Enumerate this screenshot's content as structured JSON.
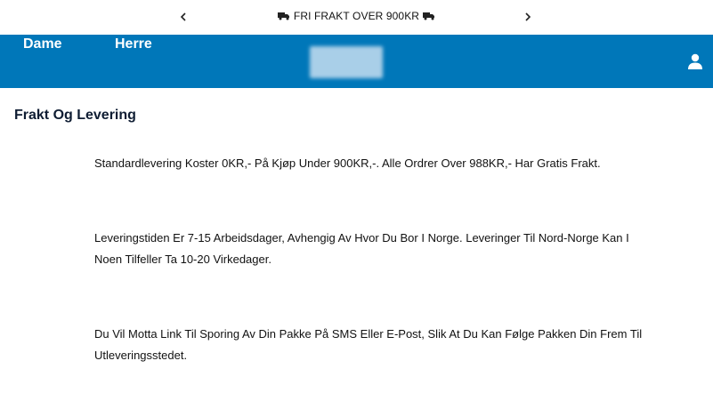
{
  "announcement": {
    "text": "FRI FRAKT OVER 900KR",
    "prev_arrow": "‹",
    "next_arrow": "›"
  },
  "nav": {
    "items": [
      {
        "label": "Dame"
      },
      {
        "label": "Herre"
      }
    ]
  },
  "colors": {
    "header_bg": "#0077b9",
    "title_color": "#0f1d33"
  },
  "page": {
    "title": "Frakt Og Levering",
    "paragraphs": [
      "Standardlevering Koster 0KR,- På Kjøp Under 900KR,-. Alle Ordrer Over 988KR,- Har Gratis Frakt.",
      "Leveringstiden Er 7-15 Arbeidsdager, Avhengig Av Hvor Du Bor I Norge. Leveringer Til Nord-Norge Kan I Noen Tilfeller Ta 10-20 Virkedager.",
      "Du Vil Motta Link Til Sporing Av Din Pakke På SMS Eller E-Post, Slik At Du Kan Følge Pakken Din Frem Til Utleveringsstedet."
    ]
  }
}
